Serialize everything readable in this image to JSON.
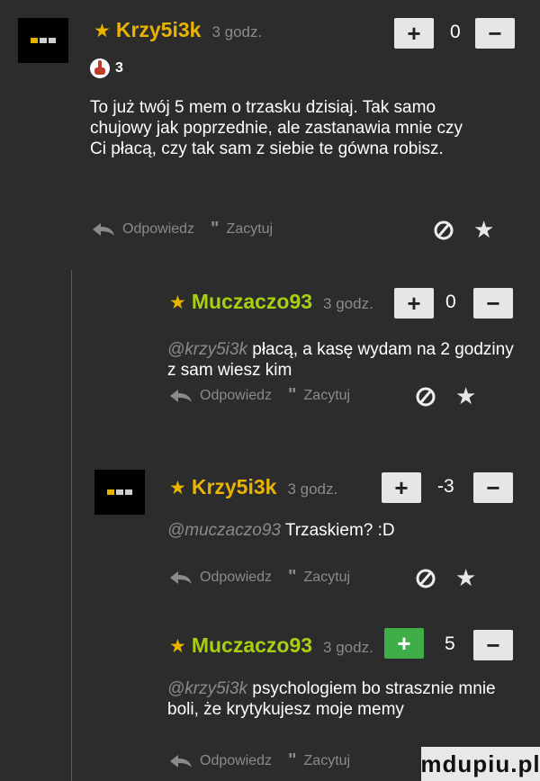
{
  "comments": [
    {
      "author": "Krzy5i3k",
      "time": "3 godz.",
      "score": "0",
      "reaction_count": "3",
      "text": "To już twój 5 mem o trzasku dzisiaj. Tak samo chujowy jak poprzednie, ale zastanawia mnie czy Ci płacą, czy tak sam z siebie te gówna robisz.",
      "reply_label": "Odpowiedz",
      "quote_label": "Zacytuj"
    },
    {
      "author": "Muczaczo93",
      "time": "3 godz.",
      "score": "0",
      "mention": "@krzy5i3k",
      "text": "płacą, a kasę wydam na 2 godziny z sam wiesz kim",
      "reply_label": "Odpowiedz",
      "quote_label": "Zacytuj"
    },
    {
      "author": "Krzy5i3k",
      "time": "3 godz.",
      "score": "-3",
      "mention": "@muczaczo93",
      "text": "Trzaskiem? :D",
      "reply_label": "Odpowiedz",
      "quote_label": "Zacytuj"
    },
    {
      "author": "Muczaczo93",
      "time": "3 godz.",
      "score": "5",
      "mention": "@krzy5i3k",
      "text": "psychologiem bo strasznie mnie boli, że krytykujesz moje memy",
      "reply_label": "Odpowiedz",
      "quote_label": "Zacytuj"
    }
  ],
  "vote": {
    "plus": "+",
    "minus": "−"
  },
  "watermark": "mdupiu.pl",
  "colors": {
    "gold": "#e8b400",
    "green": "#a8d010",
    "vote_green": "#3fae49",
    "background": "#2c2c2c"
  }
}
